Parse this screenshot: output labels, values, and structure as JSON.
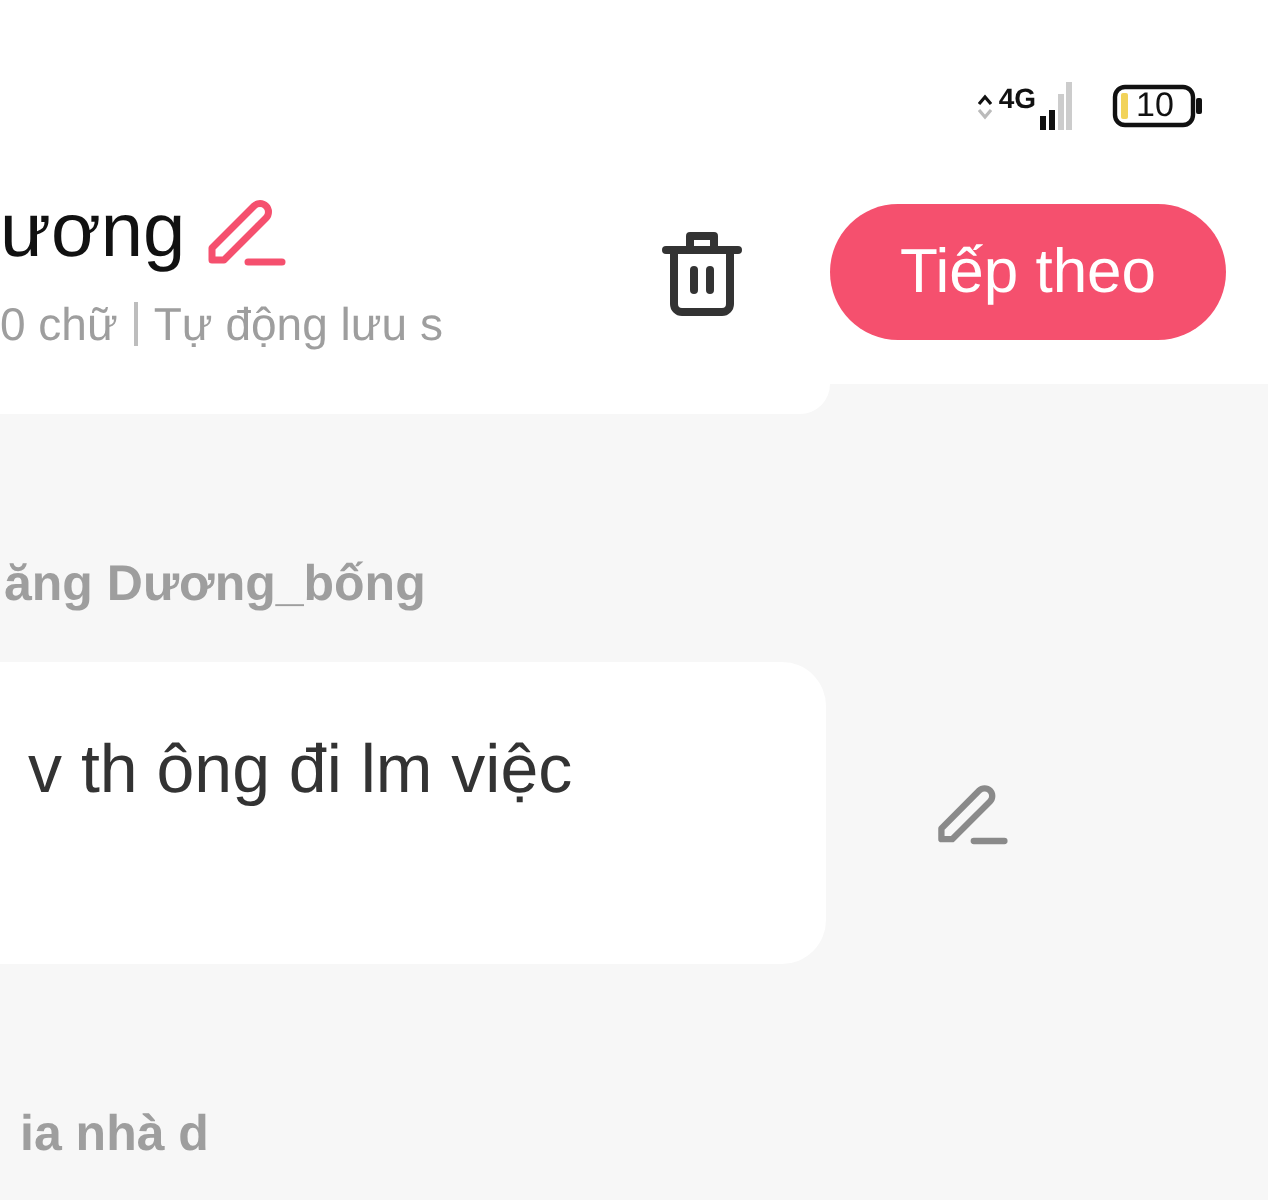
{
  "status_bar": {
    "network": "4G",
    "battery": "10"
  },
  "header": {
    "title": "ương",
    "word_count": "0 chữ",
    "save_status": "Tự động lưu s",
    "next_button": "Tiếp theo"
  },
  "sections": [
    {
      "label": "ăng Dương_bống",
      "text": "v th ông đi lm việc"
    },
    {
      "label": "ia nhà d"
    }
  ]
}
